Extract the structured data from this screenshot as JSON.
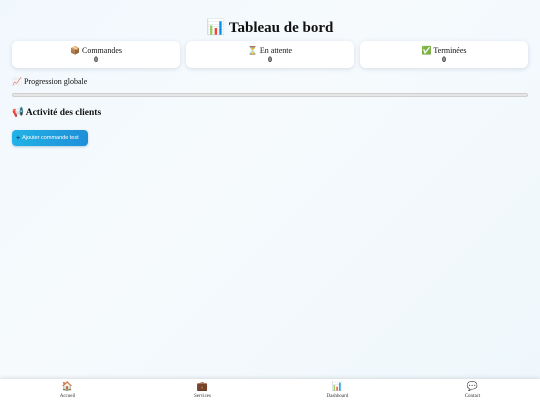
{
  "header": {
    "title_icon": "bar-chart-icon",
    "title_icon_glyph": "📊",
    "title": "Tableau de bord"
  },
  "stats": [
    {
      "icon": "package-icon",
      "glyph": "📦",
      "label": "Commandes",
      "value": "0"
    },
    {
      "icon": "hourglass-icon",
      "glyph": "⏳",
      "label": "En attente",
      "value": "0"
    },
    {
      "icon": "check-icon",
      "glyph": "✅",
      "label": "Terminées",
      "value": "0"
    }
  ],
  "progress": {
    "icon": "trending-up-icon",
    "glyph": "📈",
    "label": "Progression globale",
    "fraction": 0
  },
  "activity": {
    "icon": "megaphone-icon",
    "glyph": "📢",
    "title": "Activité des clients",
    "add_button_glyph": "+",
    "add_button_label": "Ajouter commande test"
  },
  "nav": [
    {
      "icon": "home-icon",
      "glyph": "🏠",
      "label": "Accueil"
    },
    {
      "icon": "briefcase-icon",
      "glyph": "💼",
      "label": "Services"
    },
    {
      "icon": "chart-icon",
      "glyph": "📊",
      "label": "Dashboard"
    },
    {
      "icon": "chat-icon",
      "glyph": "💬",
      "label": "Contact"
    }
  ],
  "colors": {
    "accent": "#2f80ed",
    "button_start": "#21b3e6",
    "button_end": "#1f8ed8"
  }
}
